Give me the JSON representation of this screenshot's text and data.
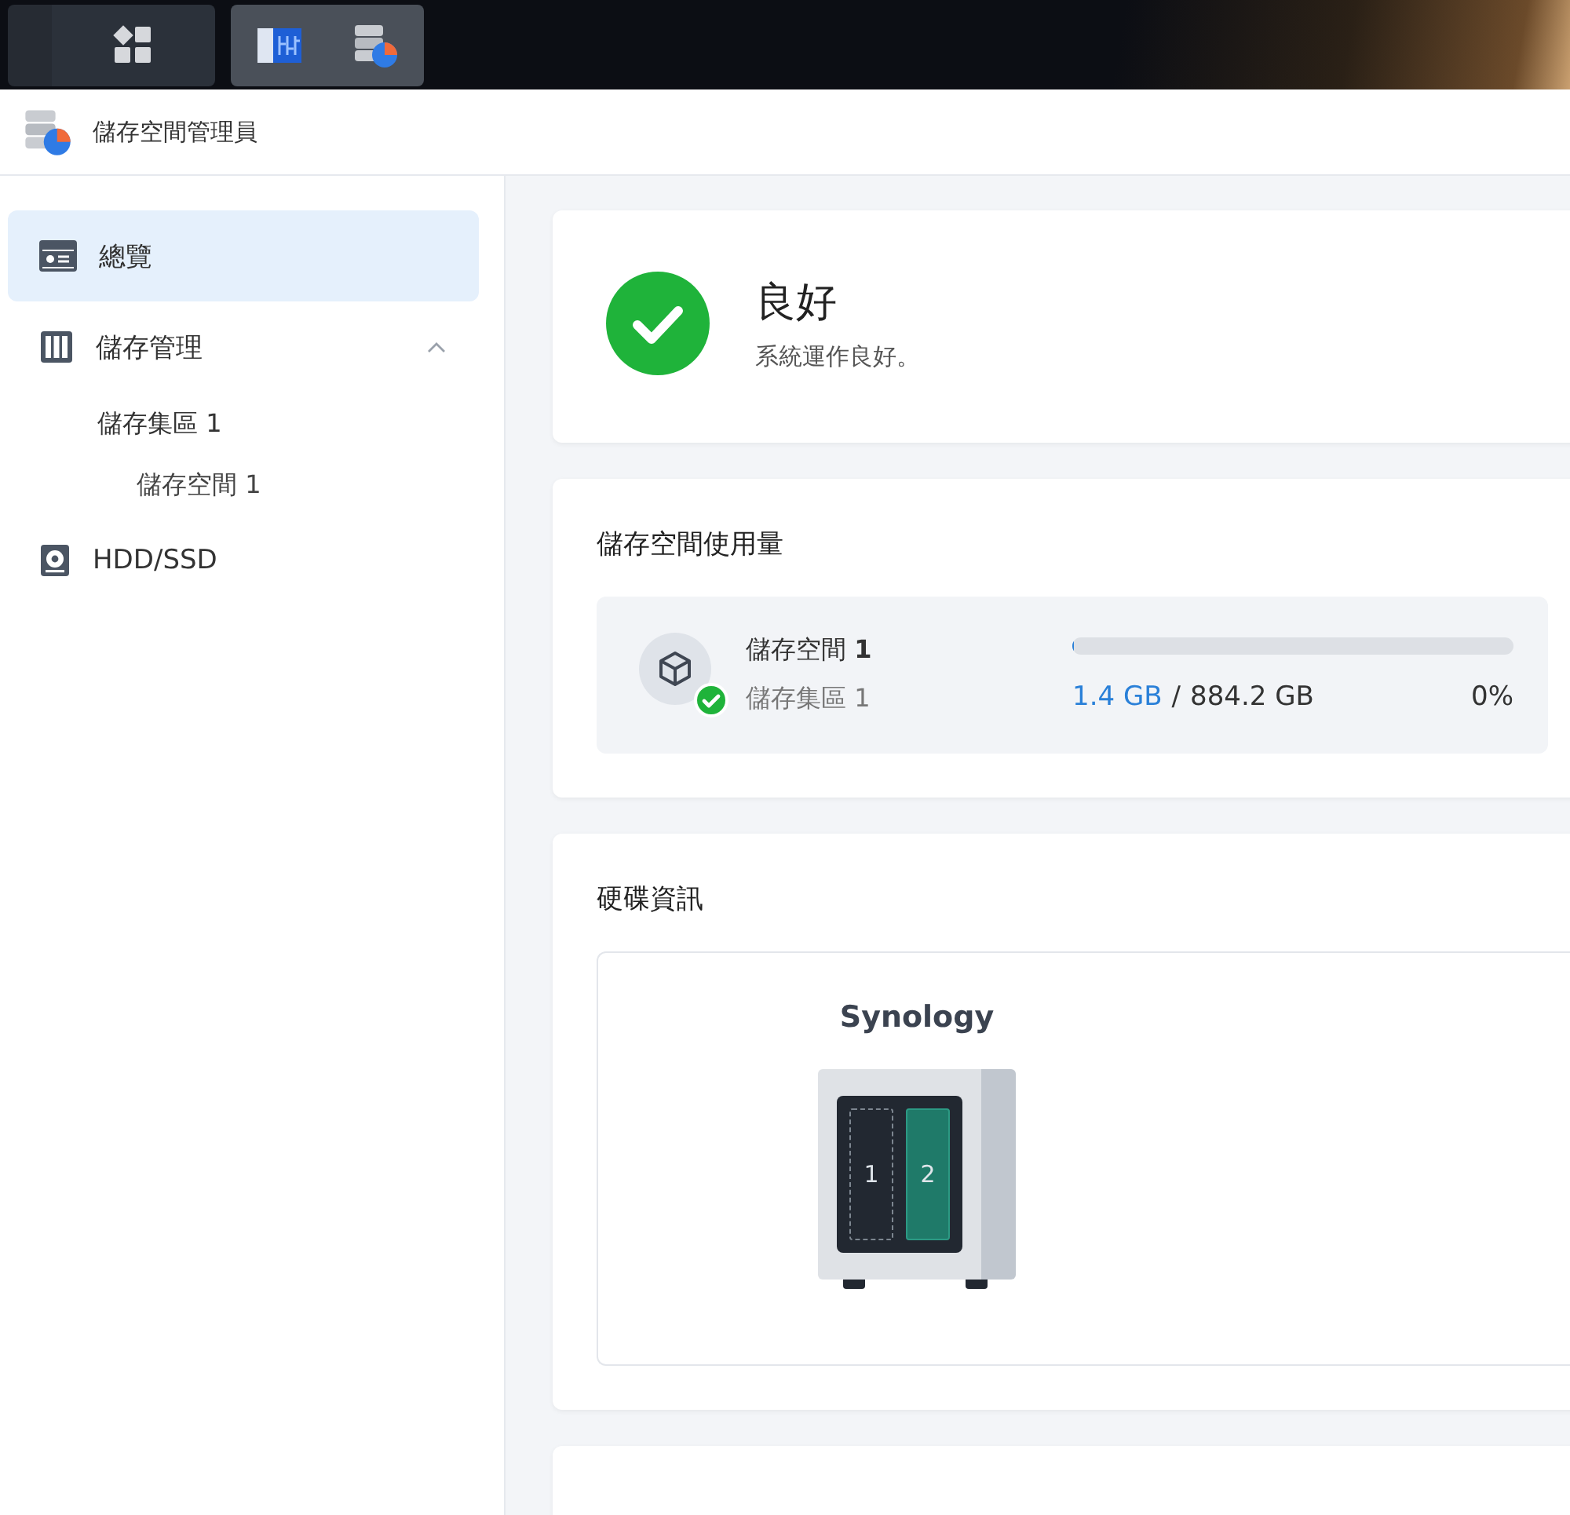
{
  "window": {
    "title": "儲存空間管理員"
  },
  "sidebar": {
    "items": [
      {
        "label": "總覽",
        "kind": "overview",
        "selected": true
      },
      {
        "label": "儲存管理",
        "kind": "storage",
        "selected": false,
        "expanded": true,
        "children": [
          {
            "label": "儲存集區 1",
            "selected": false,
            "children": [
              {
                "label": "儲存空間 1",
                "selected": false
              }
            ]
          }
        ]
      },
      {
        "label": "HDD/SSD",
        "kind": "disk",
        "selected": false
      }
    ]
  },
  "status": {
    "title": "良好",
    "message": "系統運作良好。",
    "healthy": true
  },
  "usage": {
    "title": "儲存空間使用量",
    "volumes": [
      {
        "name": "儲存空間 **1**",
        "pool": "儲存集區 1",
        "used": "1.4 GB",
        "separator": "/",
        "total": "884.2 GB",
        "percent": "0%",
        "level": 0.002,
        "healthy": true
      }
    ]
  },
  "disks": {
    "title": "硬碟資訊",
    "device": {
      "brand": "Synology",
      "slots": [
        {
          "number": "1",
          "installed": false
        },
        {
          "number": "2",
          "installed": true
        }
      ]
    }
  }
}
